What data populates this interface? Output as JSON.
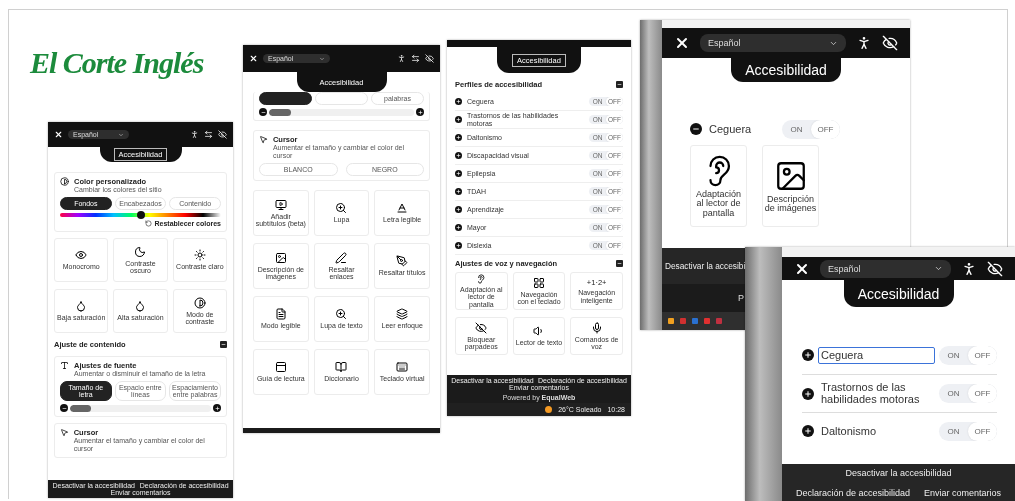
{
  "logo": "El Corte Inglés",
  "panels": [
    {
      "kind": "widget",
      "header": {
        "kind": "full",
        "language": "Español",
        "title": "Accesibilidad",
        "title_focused": true,
        "resize_icon": true
      },
      "sections": [
        {
          "kind": "color-card",
          "title": "Color personalizado",
          "subtitle": "Cambiar los colores del sitio",
          "tabs": [
            {
              "label": "Fondos",
              "selected": true
            },
            {
              "label": "Encabezados",
              "selected": false
            },
            {
              "label": "Contenido",
              "selected": false
            }
          ],
          "level": 0.5,
          "reset": "Restablecer colores"
        },
        {
          "kind": "tiles",
          "items": [
            {
              "label": "Monocromo"
            },
            {
              "label": "Contraste oscuro"
            },
            {
              "label": "Contraste claro"
            },
            {
              "label": "Baja saturación"
            },
            {
              "label": "Alta saturación"
            },
            {
              "label": "Modo de contraste"
            }
          ]
        },
        {
          "kind": "heading",
          "text": "Ajuste de contenido"
        },
        {
          "kind": "font-card",
          "title": "Ajustes de fuente",
          "subtitle": "Aumentar o disminuir el tamaño de la letra",
          "tabs": [
            {
              "label": "Tamaño de letra",
              "selected": true
            },
            {
              "label": "Espacio entre líneas",
              "selected": false
            },
            {
              "label": "Espaciamiento entre palabras",
              "selected": false
            }
          ],
          "level": 0.15
        },
        {
          "kind": "cursor-card",
          "title": "Cursor",
          "subtitle": "Aumentar el tamaño y cambiar el color del cursor"
        }
      ],
      "footer": {
        "kind": "links",
        "links": [
          "Desactivar la accesibilidad",
          "Declaración de accesibilidad",
          "Enviar comentarios"
        ]
      }
    },
    {
      "kind": "widget",
      "header": {
        "kind": "full",
        "language": "Español",
        "title": "Accesibilidad",
        "resize_icon": true
      },
      "sections": [
        {
          "kind": "font-tail",
          "tabs": [
            {
              "selected": true
            },
            {
              "selected": false
            },
            {
              "label": "palabras",
              "selected": false
            }
          ],
          "level": 0.15
        },
        {
          "kind": "cursor-card",
          "title": "Cursor",
          "subtitle": "Aumentar el tamaño y cambiar el color del cursor",
          "buttons": [
            "BLANCO",
            "NEGRO"
          ]
        },
        {
          "kind": "tiles",
          "items": [
            {
              "label": "Añadir subtítulos (beta)"
            },
            {
              "label": "Lupa"
            },
            {
              "label": "Letra legible"
            },
            {
              "label": "Descripción de imágenes"
            },
            {
              "label": "Resaltar enlaces"
            },
            {
              "label": "Resaltar títulos"
            },
            {
              "label": "Modo legible"
            },
            {
              "label": "Lupa de texto"
            },
            {
              "label": "Leer enfoque"
            },
            {
              "label": "Guía de lectura"
            },
            {
              "label": "Diccionario"
            },
            {
              "label": "Teclado virtual"
            }
          ]
        }
      ],
      "footer": {
        "kind": "plain"
      }
    },
    {
      "kind": "widget",
      "header": {
        "kind": "cut",
        "title": "Accesibilidad",
        "title_focused": true
      },
      "sections": [
        {
          "kind": "heading",
          "text": "Perfiles de accesibilidad"
        },
        {
          "kind": "profiles",
          "items": [
            {
              "label": "Ceguera",
              "expanded": false,
              "on": false,
              "on_label": "ON",
              "off_label": "OFF"
            },
            {
              "label": "Trastornos de las habilidades motoras",
              "expanded": false,
              "on": false,
              "on_label": "ON",
              "off_label": "OFF"
            },
            {
              "label": "Daltonismo",
              "expanded": false,
              "on": false,
              "on_label": "ON",
              "off_label": "OFF"
            },
            {
              "label": "Discapacidad visual",
              "expanded": false,
              "on": false,
              "on_label": "ON",
              "off_label": "OFF"
            },
            {
              "label": "Epilepsia",
              "expanded": false,
              "on": false,
              "on_label": "ON",
              "off_label": "OFF"
            },
            {
              "label": "TDAH",
              "expanded": false,
              "on": false,
              "on_label": "ON",
              "off_label": "OFF"
            },
            {
              "label": "Aprendizaje",
              "expanded": false,
              "on": false,
              "on_label": "ON",
              "off_label": "OFF"
            },
            {
              "label": "Mayor",
              "expanded": false,
              "on": false,
              "on_label": "ON",
              "off_label": "OFF"
            },
            {
              "label": "Dislexia",
              "expanded": false,
              "on": false,
              "on_label": "ON",
              "off_label": "OFF"
            }
          ]
        },
        {
          "kind": "heading",
          "text": "Ajustes de voz y navegación"
        },
        {
          "kind": "tiles",
          "items": [
            {
              "label": "Adaptación al lector de pantalla"
            },
            {
              "label": "Navegación con el teclado"
            },
            {
              "label": "Navegación inteligente",
              "icon_text": "+1·2+"
            },
            {
              "label": "Bloquear parpadeos"
            },
            {
              "label": "Lector de texto"
            },
            {
              "label": "Comandos de voz"
            }
          ]
        }
      ],
      "footer": {
        "kind": "links",
        "links": [
          "Desactivar la accesibilidad",
          "Declaración de accesibilidad",
          "Enviar comentarios"
        ],
        "powered": "Powered by **EqualWeb**"
      },
      "taskbar": {
        "weather": "26°C Soleado",
        "time": "10:28"
      }
    },
    {
      "kind": "window",
      "header": {
        "kind": "full",
        "language": "Español",
        "title": "Accesibilidad"
      },
      "sections": [
        {
          "kind": "profiles",
          "items": [
            {
              "label": "Ceguera",
              "expanded": true,
              "on": false,
              "on_label": "ON",
              "off_label": "OFF"
            }
          ]
        },
        {
          "kind": "tiles",
          "items": [
            {
              "label": "Adaptación al lector de pantalla"
            },
            {
              "label": "Descripción de imágenes"
            }
          ]
        }
      ],
      "footer": {
        "kind": "links",
        "links": [
          "Desactivar la accesibi"
        ],
        "powered": "P"
      },
      "taskbar": {
        "apps": true
      }
    },
    {
      "kind": "window",
      "header": {
        "kind": "full",
        "language": "Español",
        "title": "Accesibilidad"
      },
      "sections": [
        {
          "kind": "profiles",
          "items": [
            {
              "label": "Ceguera",
              "expanded": false,
              "on": false,
              "focused": true,
              "on_label": "ON",
              "off_label": "OFF"
            },
            {
              "label": "Trastornos de las habilidades motoras",
              "expanded": false,
              "on": false,
              "on_label": "ON",
              "off_label": "OFF"
            },
            {
              "label": "Daltonismo",
              "expanded": false,
              "on": false,
              "on_label": "ON",
              "off_label": "OFF"
            }
          ]
        }
      ],
      "footer": {
        "kind": "links",
        "links": [
          "Desactivar la accesibilidad",
          "Declaración de accesibilidad",
          "Enviar comentarios"
        ]
      }
    }
  ]
}
